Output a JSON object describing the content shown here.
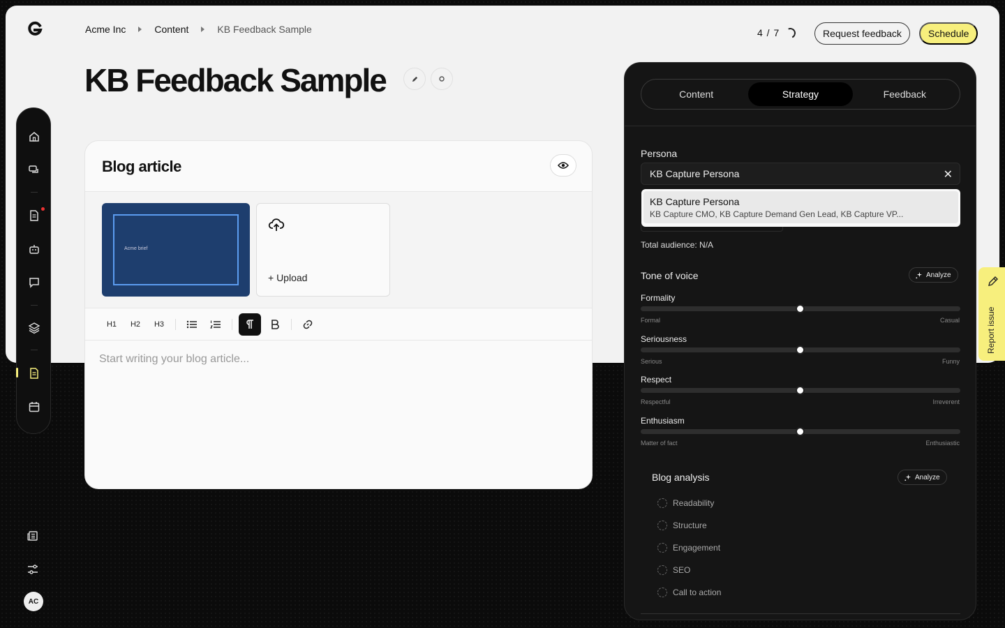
{
  "breadcrumbs": [
    "Acme Inc",
    "Content",
    "KB Feedback Sample"
  ],
  "header": {
    "counter": "4 / 7",
    "request_feedback": "Request feedback",
    "schedule": "Schedule"
  },
  "page_title": "KB Feedback Sample",
  "user": {
    "initials": "AC"
  },
  "editor": {
    "title": "Blog article",
    "thumbnail_label": "Acme brief",
    "upload_label": "+ Upload",
    "toolbar": [
      "H1",
      "H2",
      "H3"
    ],
    "placeholder": "Start writing your blog article..."
  },
  "panel": {
    "tabs": [
      "Content",
      "Strategy",
      "Feedback"
    ],
    "active_tab": "Strategy",
    "persona_label": "Persona",
    "persona_value": "KB Capture Persona",
    "dropdown": {
      "title": "KB Capture Persona",
      "subtitle": "KB Capture CMO, KB Capture Demand Gen Lead, KB Capture VP..."
    },
    "total_audience": "Total audience: N/A",
    "tone_label": "Tone of voice",
    "analyze": "Analyze",
    "sliders": [
      {
        "name": "Formality",
        "min": "Formal",
        "max": "Casual",
        "value": 0.5
      },
      {
        "name": "Seriousness",
        "min": "Serious",
        "max": "Funny",
        "value": 0.5
      },
      {
        "name": "Respect",
        "min": "Respectful",
        "max": "Irreverent",
        "value": 0.5
      },
      {
        "name": "Enthusiasm",
        "min": "Matter of fact",
        "max": "Enthusiastic",
        "value": 0.5
      }
    ],
    "analysis_label": "Blog analysis",
    "analysis_items": [
      "Readability",
      "Structure",
      "Engagement",
      "SEO",
      "Call to action"
    ]
  },
  "report_issue": "Report issue",
  "colors": {
    "accent": "#f7ef7d",
    "panel": "#151515",
    "sheet": "#f2f2f2"
  }
}
